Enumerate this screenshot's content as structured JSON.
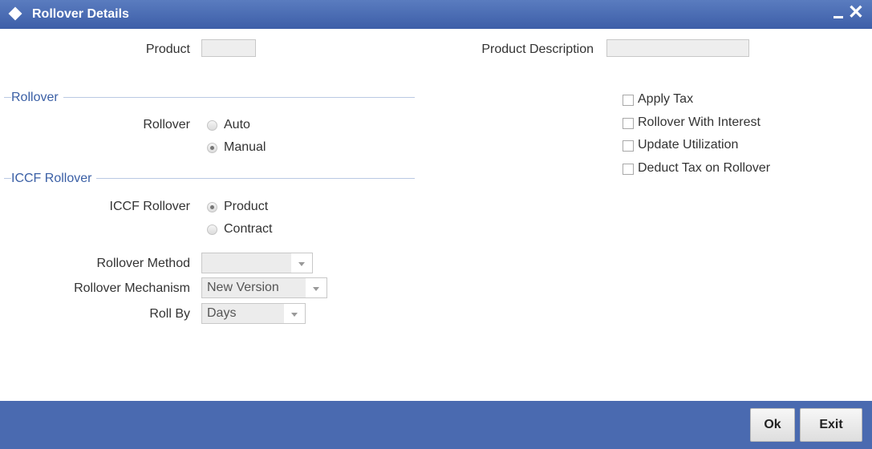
{
  "window": {
    "title": "Rollover Details"
  },
  "header": {
    "product_label": "Product",
    "product_value": "",
    "product_description_label": "Product Description",
    "product_description_value": ""
  },
  "rollover_section": {
    "title": "Rollover",
    "field_label": "Rollover",
    "options": [
      {
        "label": "Auto",
        "checked": false
      },
      {
        "label": "Manual",
        "checked": true
      }
    ]
  },
  "iccf_section": {
    "title": "ICCF Rollover",
    "field_label": "ICCF Rollover",
    "options": [
      {
        "label": "Product",
        "checked": true
      },
      {
        "label": "Contract",
        "checked": false
      }
    ]
  },
  "fields": {
    "rollover_method": {
      "label": "Rollover Method",
      "value": ""
    },
    "rollover_mechanism": {
      "label": "Rollover Mechanism",
      "value": "New Version"
    },
    "roll_by": {
      "label": "Roll By",
      "value": "Days"
    }
  },
  "checkboxes": [
    {
      "label": "Apply Tax",
      "checked": false
    },
    {
      "label": "Rollover With Interest",
      "checked": false
    },
    {
      "label": "Update Utilization",
      "checked": false
    },
    {
      "label": "Deduct Tax on Rollover",
      "checked": false
    }
  ],
  "footer": {
    "ok_label": "Ok",
    "exit_label": "Exit"
  },
  "colors": {
    "titlebar": "#4a6ab0",
    "section_title": "#3a5fa5",
    "footer": "#4a6ab0"
  }
}
